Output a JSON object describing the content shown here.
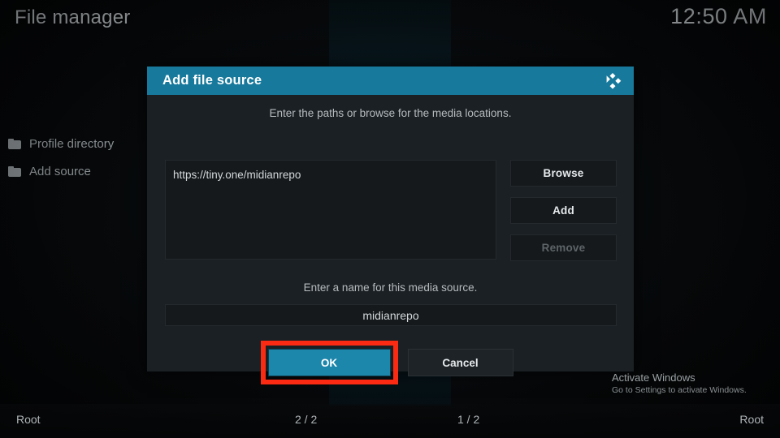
{
  "header": {
    "title": "File manager",
    "clock": "12:50 AM"
  },
  "sidebar": {
    "items": [
      {
        "label": "Profile directory",
        "icon": "folder-icon"
      },
      {
        "label": "Add source",
        "icon": "folder-icon"
      }
    ]
  },
  "dialog": {
    "title": "Add file source",
    "logo_icon": "kodi-logo-icon",
    "paths_hint": "Enter the paths or browse for the media locations.",
    "paths": [
      "https://tiny.one/midianrepo"
    ],
    "side_buttons": [
      {
        "label": "Browse",
        "disabled": false
      },
      {
        "label": "Add",
        "disabled": false
      },
      {
        "label": "Remove",
        "disabled": true
      }
    ],
    "name_hint": "Enter a name for this media source.",
    "name_value": "midianrepo",
    "ok_label": "OK",
    "cancel_label": "Cancel"
  },
  "watermark": {
    "line1": "Activate Windows",
    "line2": "Go to Settings to activate Windows."
  },
  "bottom_bar": {
    "left": "Root",
    "middle_left": "2 / 2",
    "middle_right": "1 / 2",
    "right": "Root"
  },
  "colors": {
    "accent": "#17799c",
    "ok_button": "#1d86ab",
    "highlight": "#fb2a12",
    "dialog_body": "#1b2024",
    "field": "#15191c"
  }
}
